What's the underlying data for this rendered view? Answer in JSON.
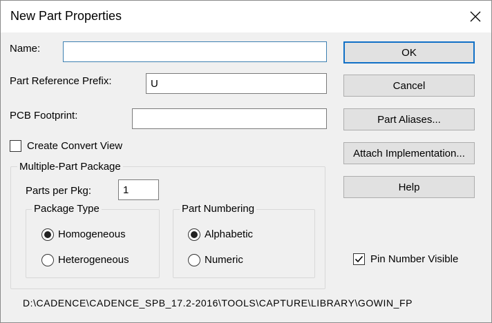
{
  "window": {
    "title": "New Part Properties",
    "close_icon": "close-icon"
  },
  "fields": {
    "name": {
      "label": "Name:",
      "value": ""
    },
    "prefix": {
      "label": "Part Reference Prefix:",
      "value": "U"
    },
    "footprint": {
      "label": "PCB Footprint:",
      "value": ""
    }
  },
  "create_convert": {
    "label": "Create Convert View",
    "checked": false
  },
  "multipart": {
    "title": "Multiple-Part Package",
    "parts_label": "Parts per Pkg:",
    "parts_value": "1",
    "package_type": {
      "title": "Package Type",
      "options": [
        {
          "label": "Homogeneous",
          "selected": true
        },
        {
          "label": "Heterogeneous",
          "selected": false
        }
      ]
    },
    "part_numbering": {
      "title": "Part Numbering",
      "options": [
        {
          "label": "Alphabetic",
          "selected": true
        },
        {
          "label": "Numeric",
          "selected": false
        }
      ]
    }
  },
  "buttons": {
    "ok": "OK",
    "cancel": "Cancel",
    "aliases": "Part Aliases...",
    "attach": "Attach Implementation...",
    "help": "Help"
  },
  "pin_number_visible": {
    "label": "Pin Number Visible",
    "checked": true
  },
  "path": "D:\\CADENCE\\CADENCE_SPB_17.2-2016\\TOOLS\\CAPTURE\\LIBRARY\\GOWIN_FP",
  "colors": {
    "focus_border": "#3c7fb1",
    "default_button_border": "#0f6fc6",
    "dialog_bg": "#f0f0f0"
  }
}
